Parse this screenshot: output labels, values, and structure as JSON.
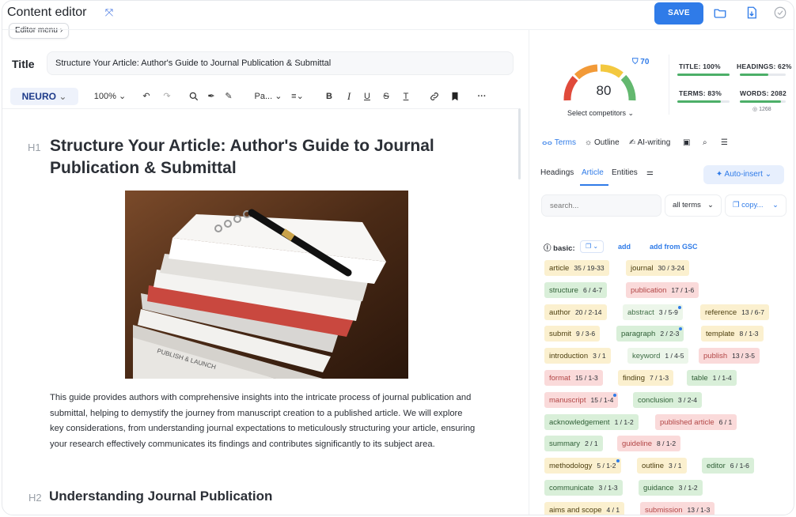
{
  "header": {
    "title": "Content editor",
    "editor_menu": "Editor menu",
    "save_label": "SAVE"
  },
  "editor": {
    "title_label": "Title",
    "title_value": "Structure Your Article: Author's Guide to Journal Publication & Submittal",
    "toolbar": {
      "neuro": "NEURO",
      "zoom": "100%",
      "paragraph": "Pa...",
      "more": "···"
    },
    "h1_tag": "H1",
    "h1_text": "Structure Your Article: Author's Guide to Journal Publication & Submittal",
    "body": "This guide provides authors with comprehensive insights into the intricate process of journal publication and submittal, helping to demystify the journey from manuscript creation to a published article. We will explore key considerations, from understanding journal expectations to meticulously structuring your article, ensuring your research effectively communicates its findings and contributes significantly to its subject area.",
    "h2_tag": "H2",
    "h2_text": "Understanding Journal Publication",
    "image_label": "PUBLISH & LAUNCH"
  },
  "score": {
    "value": "80",
    "competitors": "70",
    "select_competitors": "Select competitors",
    "small_count": "1268",
    "metrics": [
      {
        "label": "TITLE: 100%",
        "fill": 1.0
      },
      {
        "label": "HEADINGS: 62%",
        "fill": 0.62
      },
      {
        "label": "TERMS: 83%",
        "fill": 0.83
      },
      {
        "label": "WORDS: 2082",
        "fill": 0.9
      }
    ]
  },
  "panel": {
    "tabs": [
      "Terms",
      "Outline",
      "AI-writing"
    ],
    "subtabs": [
      "Headings",
      "Article",
      "Entities"
    ],
    "auto_insert": "Auto-insert",
    "search_placeholder": "search...",
    "filter": "all terms",
    "copy": "copy...",
    "basic_label": "basic:",
    "add": "add",
    "add_gsc": "add from GSC"
  },
  "terms": [
    {
      "term": "article",
      "count": "35 / 19-33",
      "color": "yellow"
    },
    {
      "term": "journal",
      "count": "30 / 3-24",
      "color": "yellow"
    },
    {
      "term": "structure",
      "count": "6 / 4-7",
      "color": "green"
    },
    {
      "term": "publication",
      "count": "17 / 1-6",
      "color": "red"
    },
    {
      "term": "author",
      "count": "20 / 2-14",
      "color": "yellow"
    },
    {
      "term": "abstract",
      "count": "3 / 5-9",
      "color": "lgreen",
      "dot": true
    },
    {
      "term": "reference",
      "count": "13 / 6-7",
      "color": "yellow"
    },
    {
      "term": "submit",
      "count": "9 / 3-6",
      "color": "yellow"
    },
    {
      "term": "paragraph",
      "count": "2 / 2-3",
      "color": "green",
      "dot": true
    },
    {
      "term": "template",
      "count": "8 / 1-3",
      "color": "yellow"
    },
    {
      "term": "introduction",
      "count": "3 / 1",
      "color": "yellow"
    },
    {
      "term": "keyword",
      "count": "1 / 4-5",
      "color": "lgreen"
    },
    {
      "term": "publish",
      "count": "13 / 3-5",
      "color": "red"
    },
    {
      "term": "format",
      "count": "15 / 1-3",
      "color": "red"
    },
    {
      "term": "finding",
      "count": "7 / 1-3",
      "color": "yellow"
    },
    {
      "term": "table",
      "count": "1 / 1-4",
      "color": "green"
    },
    {
      "term": "manuscript",
      "count": "15 / 1-4",
      "color": "red",
      "dot": true
    },
    {
      "term": "conclusion",
      "count": "3 / 2-4",
      "color": "green"
    },
    {
      "term": "acknowledgement",
      "count": "1 / 1-2",
      "color": "green"
    },
    {
      "term": "published article",
      "count": "6 / 1",
      "color": "red"
    },
    {
      "term": "summary",
      "count": "2 / 1",
      "color": "green"
    },
    {
      "term": "guideline",
      "count": "8 / 1-2",
      "color": "red"
    },
    {
      "term": "methodology",
      "count": "5 / 1-2",
      "color": "yellow",
      "dot": true
    },
    {
      "term": "outline",
      "count": "3 / 1",
      "color": "yellow"
    },
    {
      "term": "editor",
      "count": "6 / 1-6",
      "color": "green"
    },
    {
      "term": "communicate",
      "count": "3 / 1-3",
      "color": "green"
    },
    {
      "term": "guidance",
      "count": "3 / 1-2",
      "color": "green"
    },
    {
      "term": "aims and scope",
      "count": "4 / 1",
      "color": "yellow"
    },
    {
      "term": "submission",
      "count": "13 / 1-3",
      "color": "red"
    }
  ]
}
